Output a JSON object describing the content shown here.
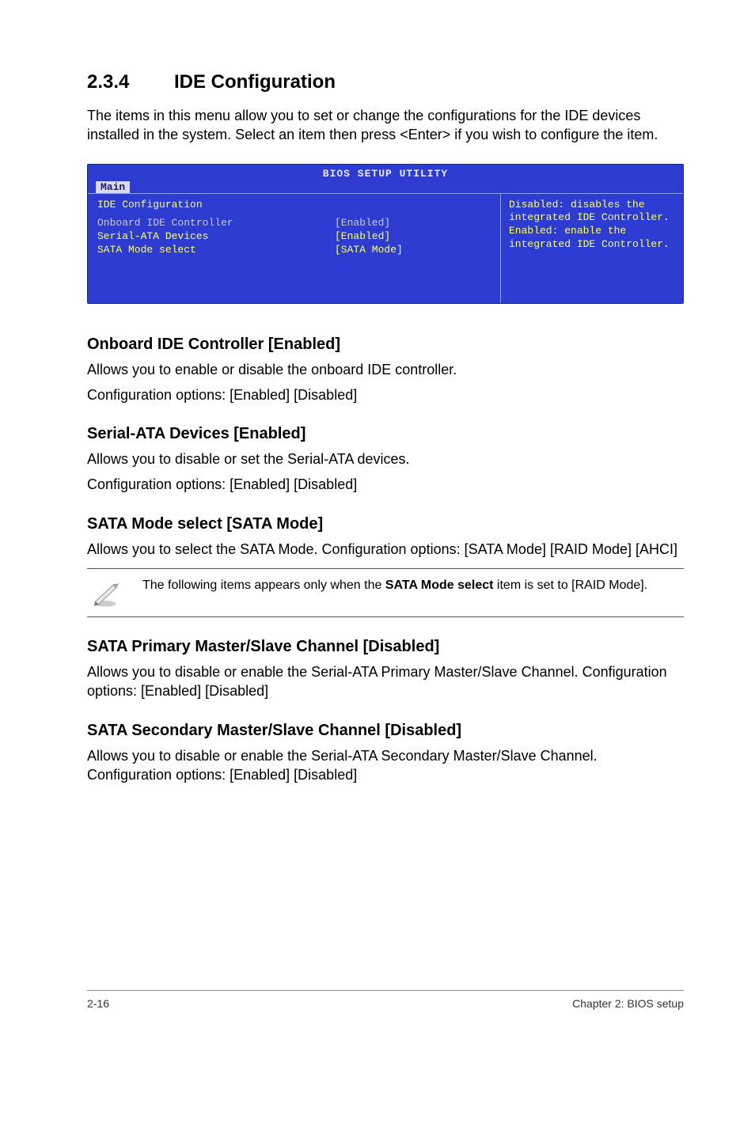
{
  "section": {
    "number": "2.3.4",
    "title": "IDE Configuration"
  },
  "intro": "The items in this menu allow you to set or change the configurations for the IDE devices installed in the system. Select an item then press <Enter> if you wish to configure the item.",
  "bios": {
    "headline": "BIOS SETUP UTILITY",
    "tab": "Main",
    "panel_title": "IDE Configuration",
    "rows": [
      {
        "label": "Onboard IDE Controller",
        "value": "[Enabled]",
        "style": "grey"
      },
      {
        "label": "Serial-ATA Devices",
        "value": "[Enabled]",
        "style": "yellow"
      },
      {
        "label": "SATA Mode select",
        "value": "[SATA Mode]",
        "style": "yellow"
      }
    ],
    "help": "Disabled: disables the integrated IDE Controller.\nEnabled: enable the integrated IDE Controller."
  },
  "subs": {
    "onboard": {
      "h": "Onboard IDE Controller [Enabled]",
      "p1": "Allows you to enable or disable the onboard IDE controller.",
      "p2": "Configuration options: [Enabled] [Disabled]"
    },
    "serialata": {
      "h": "Serial-ATA Devices [Enabled]",
      "p1": "Allows you to disable or set the Serial-ATA devices.",
      "p2": "Configuration options: [Enabled] [Disabled]"
    },
    "satamode": {
      "h": "SATA Mode select [SATA Mode]",
      "p1": "Allows you to select the SATA Mode. Configuration options: [SATA Mode] [RAID Mode] [AHCI]"
    },
    "primary": {
      "h": "SATA Primary Master/Slave Channel [Disabled]",
      "p1": "Allows you to disable or enable the Serial-ATA Primary Master/Slave Channel. Configuration options: [Enabled] [Disabled]"
    },
    "secondary": {
      "h": "SATA Secondary Master/Slave Channel [Disabled]",
      "p1": "Allows you to disable or enable the Serial-ATA Secondary Master/Slave Channel. Configuration options: [Enabled] [Disabled]"
    }
  },
  "note": {
    "pre": "The following items appears only when the ",
    "bold": "SATA Mode select",
    "post": " item is set to [RAID Mode]."
  },
  "footer": {
    "left": "2-16",
    "right": "Chapter 2: BIOS setup"
  }
}
